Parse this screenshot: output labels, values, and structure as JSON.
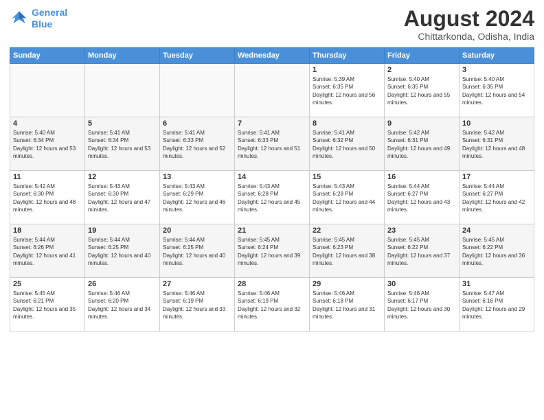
{
  "header": {
    "logo_line1": "General",
    "logo_line2": "Blue",
    "month": "August 2024",
    "location": "Chittarkonda, Odisha, India"
  },
  "days_of_week": [
    "Sunday",
    "Monday",
    "Tuesday",
    "Wednesday",
    "Thursday",
    "Friday",
    "Saturday"
  ],
  "weeks": [
    [
      {
        "day": "",
        "empty": true
      },
      {
        "day": "",
        "empty": true
      },
      {
        "day": "",
        "empty": true
      },
      {
        "day": "",
        "empty": true
      },
      {
        "day": "1",
        "sunrise": "5:39 AM",
        "sunset": "6:35 PM",
        "daylight": "12 hours and 56 minutes."
      },
      {
        "day": "2",
        "sunrise": "5:40 AM",
        "sunset": "6:35 PM",
        "daylight": "12 hours and 55 minutes."
      },
      {
        "day": "3",
        "sunrise": "5:40 AM",
        "sunset": "6:35 PM",
        "daylight": "12 hours and 54 minutes."
      }
    ],
    [
      {
        "day": "4",
        "sunrise": "5:40 AM",
        "sunset": "6:34 PM",
        "daylight": "12 hours and 53 minutes."
      },
      {
        "day": "5",
        "sunrise": "5:41 AM",
        "sunset": "6:34 PM",
        "daylight": "12 hours and 53 minutes."
      },
      {
        "day": "6",
        "sunrise": "5:41 AM",
        "sunset": "6:33 PM",
        "daylight": "12 hours and 52 minutes."
      },
      {
        "day": "7",
        "sunrise": "5:41 AM",
        "sunset": "6:33 PM",
        "daylight": "12 hours and 51 minutes."
      },
      {
        "day": "8",
        "sunrise": "5:41 AM",
        "sunset": "6:32 PM",
        "daylight": "12 hours and 50 minutes."
      },
      {
        "day": "9",
        "sunrise": "5:42 AM",
        "sunset": "6:31 PM",
        "daylight": "12 hours and 49 minutes."
      },
      {
        "day": "10",
        "sunrise": "5:42 AM",
        "sunset": "6:31 PM",
        "daylight": "12 hours and 48 minutes."
      }
    ],
    [
      {
        "day": "11",
        "sunrise": "5:42 AM",
        "sunset": "6:30 PM",
        "daylight": "12 hours and 48 minutes."
      },
      {
        "day": "12",
        "sunrise": "5:43 AM",
        "sunset": "6:30 PM",
        "daylight": "12 hours and 47 minutes."
      },
      {
        "day": "13",
        "sunrise": "5:43 AM",
        "sunset": "6:29 PM",
        "daylight": "12 hours and 46 minutes."
      },
      {
        "day": "14",
        "sunrise": "5:43 AM",
        "sunset": "6:28 PM",
        "daylight": "12 hours and 45 minutes."
      },
      {
        "day": "15",
        "sunrise": "5:43 AM",
        "sunset": "6:28 PM",
        "daylight": "12 hours and 44 minutes."
      },
      {
        "day": "16",
        "sunrise": "5:44 AM",
        "sunset": "6:27 PM",
        "daylight": "12 hours and 43 minutes."
      },
      {
        "day": "17",
        "sunrise": "5:44 AM",
        "sunset": "6:27 PM",
        "daylight": "12 hours and 42 minutes."
      }
    ],
    [
      {
        "day": "18",
        "sunrise": "5:44 AM",
        "sunset": "6:26 PM",
        "daylight": "12 hours and 41 minutes."
      },
      {
        "day": "19",
        "sunrise": "5:44 AM",
        "sunset": "6:25 PM",
        "daylight": "12 hours and 40 minutes."
      },
      {
        "day": "20",
        "sunrise": "5:44 AM",
        "sunset": "6:25 PM",
        "daylight": "12 hours and 40 minutes."
      },
      {
        "day": "21",
        "sunrise": "5:45 AM",
        "sunset": "6:24 PM",
        "daylight": "12 hours and 39 minutes."
      },
      {
        "day": "22",
        "sunrise": "5:45 AM",
        "sunset": "6:23 PM",
        "daylight": "12 hours and 38 minutes."
      },
      {
        "day": "23",
        "sunrise": "5:45 AM",
        "sunset": "6:22 PM",
        "daylight": "12 hours and 37 minutes."
      },
      {
        "day": "24",
        "sunrise": "5:45 AM",
        "sunset": "6:22 PM",
        "daylight": "12 hours and 36 minutes."
      }
    ],
    [
      {
        "day": "25",
        "sunrise": "5:45 AM",
        "sunset": "6:21 PM",
        "daylight": "12 hours and 35 minutes."
      },
      {
        "day": "26",
        "sunrise": "5:46 AM",
        "sunset": "6:20 PM",
        "daylight": "12 hours and 34 minutes."
      },
      {
        "day": "27",
        "sunrise": "5:46 AM",
        "sunset": "6:19 PM",
        "daylight": "12 hours and 33 minutes."
      },
      {
        "day": "28",
        "sunrise": "5:46 AM",
        "sunset": "6:19 PM",
        "daylight": "12 hours and 32 minutes."
      },
      {
        "day": "29",
        "sunrise": "5:46 AM",
        "sunset": "6:18 PM",
        "daylight": "12 hours and 31 minutes."
      },
      {
        "day": "30",
        "sunrise": "5:46 AM",
        "sunset": "6:17 PM",
        "daylight": "12 hours and 30 minutes."
      },
      {
        "day": "31",
        "sunrise": "5:47 AM",
        "sunset": "6:16 PM",
        "daylight": "12 hours and 29 minutes."
      }
    ]
  ]
}
